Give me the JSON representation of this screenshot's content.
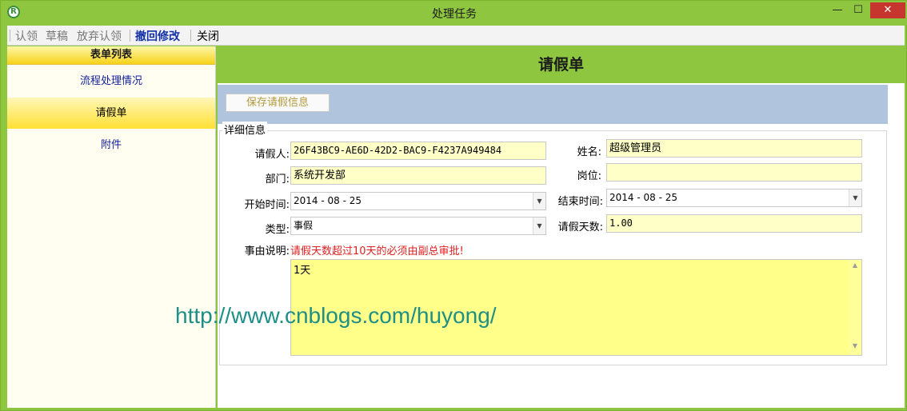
{
  "window": {
    "title": "处理任务",
    "app_icon": "R",
    "min_glyph": "—",
    "max_glyph": "☐",
    "close_glyph": "✕"
  },
  "toolbar": {
    "claim": "认领",
    "draft": "草稿",
    "abandon": "放弃认领",
    "revoke": "撤回修改",
    "close": "关闭"
  },
  "sidebar": {
    "header": "表单列表",
    "items": [
      {
        "label": "流程处理情况"
      },
      {
        "label": "请假单"
      },
      {
        "label": "附件"
      }
    ]
  },
  "form": {
    "title": "请假单",
    "save_label": "保存请假信息",
    "section_title": "详细信息",
    "applicant_label": "请假人:",
    "applicant_value": "26F43BC9-AE6D-42D2-BAC9-F4237A949484",
    "name_label": "姓名:",
    "name_value": "超级管理员",
    "department_label": "部门:",
    "department_value": "系统开发部",
    "position_label": "岗位:",
    "position_value": "",
    "start_label": "开始时间:",
    "start_value": "2014 - 08 - 25",
    "end_label": "结束时间:",
    "end_value": "2014 - 08 - 25",
    "type_label": "类型:",
    "type_value": "事假",
    "days_label": "请假天数:",
    "days_value": "1.00",
    "reason_label": "事由说明:",
    "reason_note": "请假天数超过10天的必须由副总审批!",
    "reason_value": "1天"
  },
  "watermark": "http://www.cnblogs.com/huyong/"
}
